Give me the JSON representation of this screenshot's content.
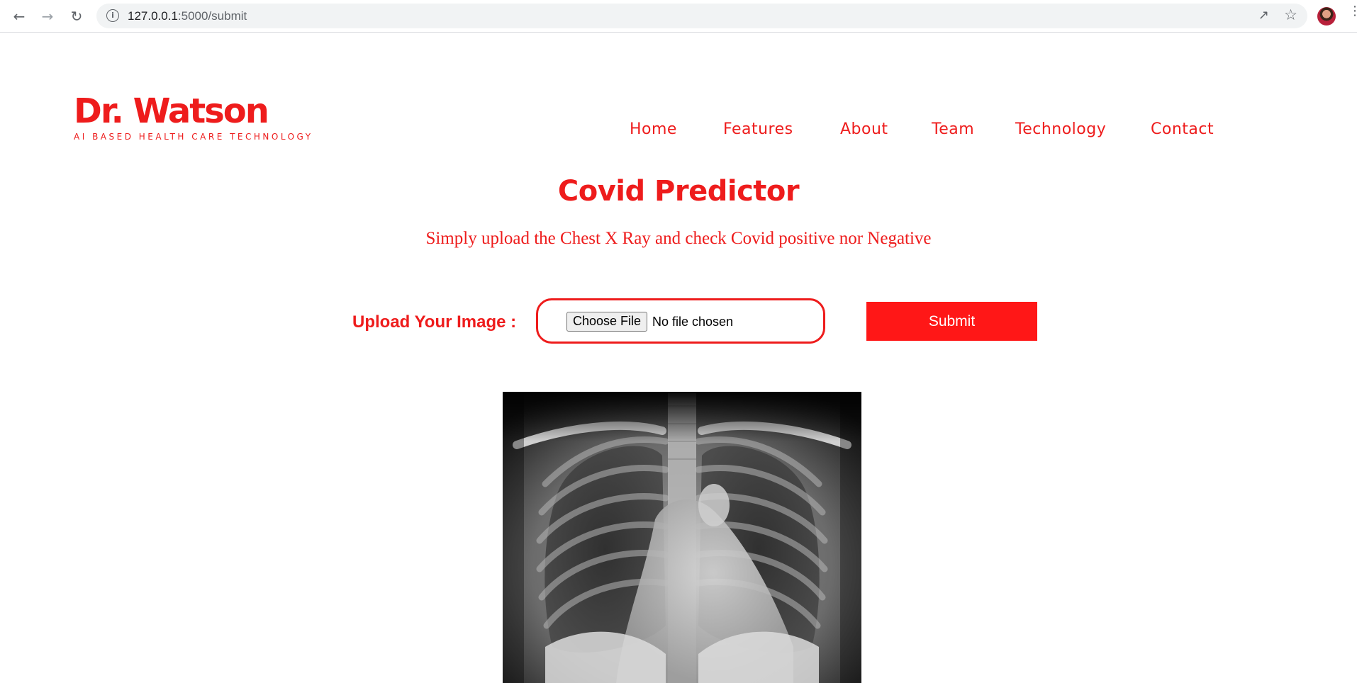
{
  "browser": {
    "url_host": "127.0.0.1",
    "url_path": ":5000/submit",
    "icons": [
      "back-icon",
      "forward-icon",
      "reload-icon",
      "info-icon",
      "share-icon",
      "star-icon",
      "profile-avatar",
      "menu-icon"
    ]
  },
  "brand": {
    "name": "Dr. Watson",
    "tagline": "AI BASED HEALTH CARE TECHNOLOGY"
  },
  "nav": {
    "items": [
      {
        "label": "Home"
      },
      {
        "label": "Features"
      },
      {
        "label": "About"
      },
      {
        "label": "Team"
      },
      {
        "label": "Technology"
      },
      {
        "label": "Contact"
      }
    ]
  },
  "main": {
    "title": "Covid Predictor",
    "subtitle": "Simply upload the Chest X Ray and check Covid positive nor Negative",
    "upload_label": "Upload Your Image :",
    "choose_file_label": "Choose File",
    "file_status": "No file chosen",
    "submit_label": "Submit"
  },
  "colors": {
    "accent": "#ee1c1c",
    "button": "#ff1717"
  }
}
